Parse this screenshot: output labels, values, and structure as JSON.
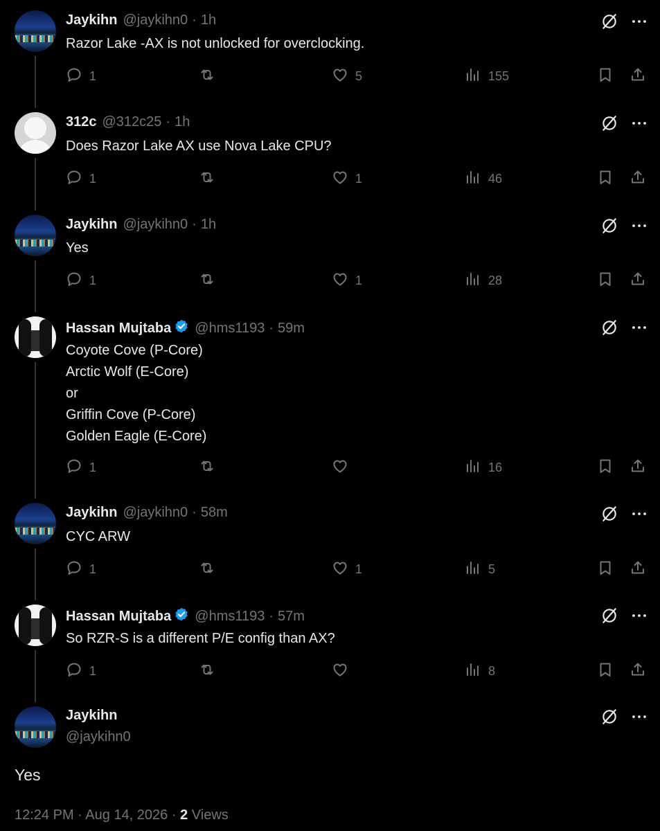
{
  "tweets": [
    {
      "name": "Jaykihn",
      "handle": "@jaykihn0",
      "time": "1h",
      "verified": false,
      "avatar": "jay",
      "text": "Razor Lake -AX is not unlocked for overclocking.",
      "replies": "1",
      "reposts": "",
      "likes": "5",
      "views": "155"
    },
    {
      "name": "312c",
      "handle": "@312c25",
      "time": "1h",
      "verified": false,
      "avatar": "312",
      "text": "Does Razor Lake AX use Nova Lake CPU?",
      "replies": "1",
      "reposts": "",
      "likes": "1",
      "views": "46"
    },
    {
      "name": "Jaykihn",
      "handle": "@jaykihn0",
      "time": "1h",
      "verified": false,
      "avatar": "jay",
      "text": "Yes",
      "replies": "1",
      "reposts": "",
      "likes": "1",
      "views": "28"
    },
    {
      "name": "Hassan Mujtaba",
      "handle": "@hms1193",
      "time": "59m",
      "verified": true,
      "avatar": "has",
      "text": "Coyote Cove (P-Core)\nArctic Wolf (E-Core)\nor\nGriffin Cove (P-Core)\nGolden Eagle (E-Core)",
      "replies": "1",
      "reposts": "",
      "likes": "",
      "views": "16"
    },
    {
      "name": "Jaykihn",
      "handle": "@jaykihn0",
      "time": "58m",
      "verified": false,
      "avatar": "jay",
      "text": "CYC ARW",
      "replies": "1",
      "reposts": "",
      "likes": "1",
      "views": "5"
    },
    {
      "name": "Hassan Mujtaba",
      "handle": "@hms1193",
      "time": "57m",
      "verified": true,
      "avatar": "has",
      "text": "So RZR-S is a different P/E config than AX?",
      "replies": "1",
      "reposts": "",
      "likes": "",
      "views": "8"
    }
  ],
  "main_tweet": {
    "name": "Jaykihn",
    "handle": "@jaykihn0",
    "text": "Yes",
    "time": "12:24 PM",
    "date": "Aug 14, 2026",
    "views_count": "2",
    "views_label": "Views"
  },
  "separator": "·",
  "colors": {
    "background": "#000000",
    "text": "#e7e9ea",
    "muted": "#71767b",
    "verified": "#1d9bf0",
    "thread_line": "#333639"
  },
  "icons": [
    "grok-icon",
    "more-icon",
    "reply-icon",
    "repost-icon",
    "like-icon",
    "views-icon",
    "bookmark-icon",
    "share-icon",
    "verified-badge-icon"
  ]
}
